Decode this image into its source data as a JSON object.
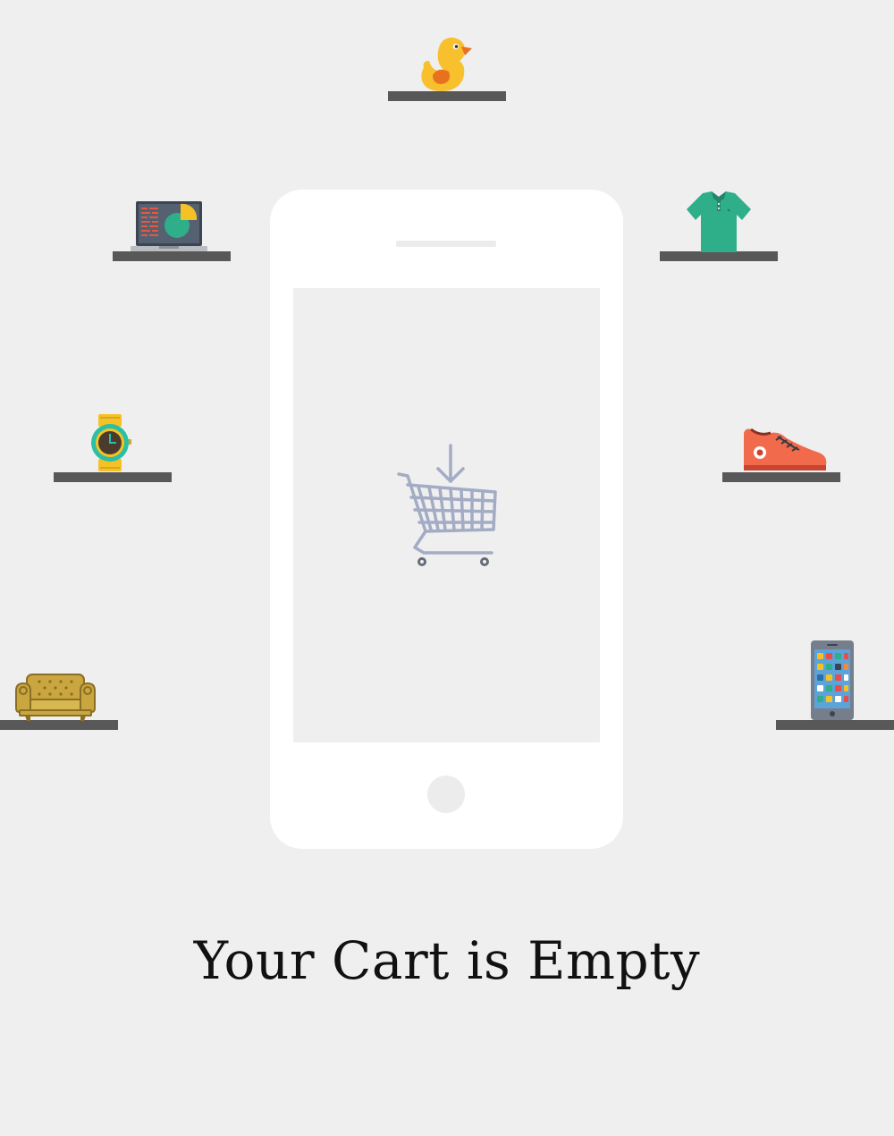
{
  "empty_cart": {
    "message": "Your Cart is Empty",
    "center_icon": "cart-download-icon"
  },
  "products": [
    {
      "name": "rubber-duck",
      "icon": "rubber-duck-icon"
    },
    {
      "name": "laptop",
      "icon": "laptop-icon"
    },
    {
      "name": "polo-shirt",
      "icon": "polo-shirt-icon"
    },
    {
      "name": "wrist-watch",
      "icon": "wrist-watch-icon"
    },
    {
      "name": "sneaker",
      "icon": "sneaker-icon"
    },
    {
      "name": "armchair",
      "icon": "armchair-icon"
    },
    {
      "name": "smartphone",
      "icon": "smartphone-icon"
    }
  ],
  "colors": {
    "background": "#efefef",
    "shelf": "#585858",
    "phone_body": "#ffffff",
    "cart_icon": "#a3acc4",
    "text": "#111111"
  }
}
